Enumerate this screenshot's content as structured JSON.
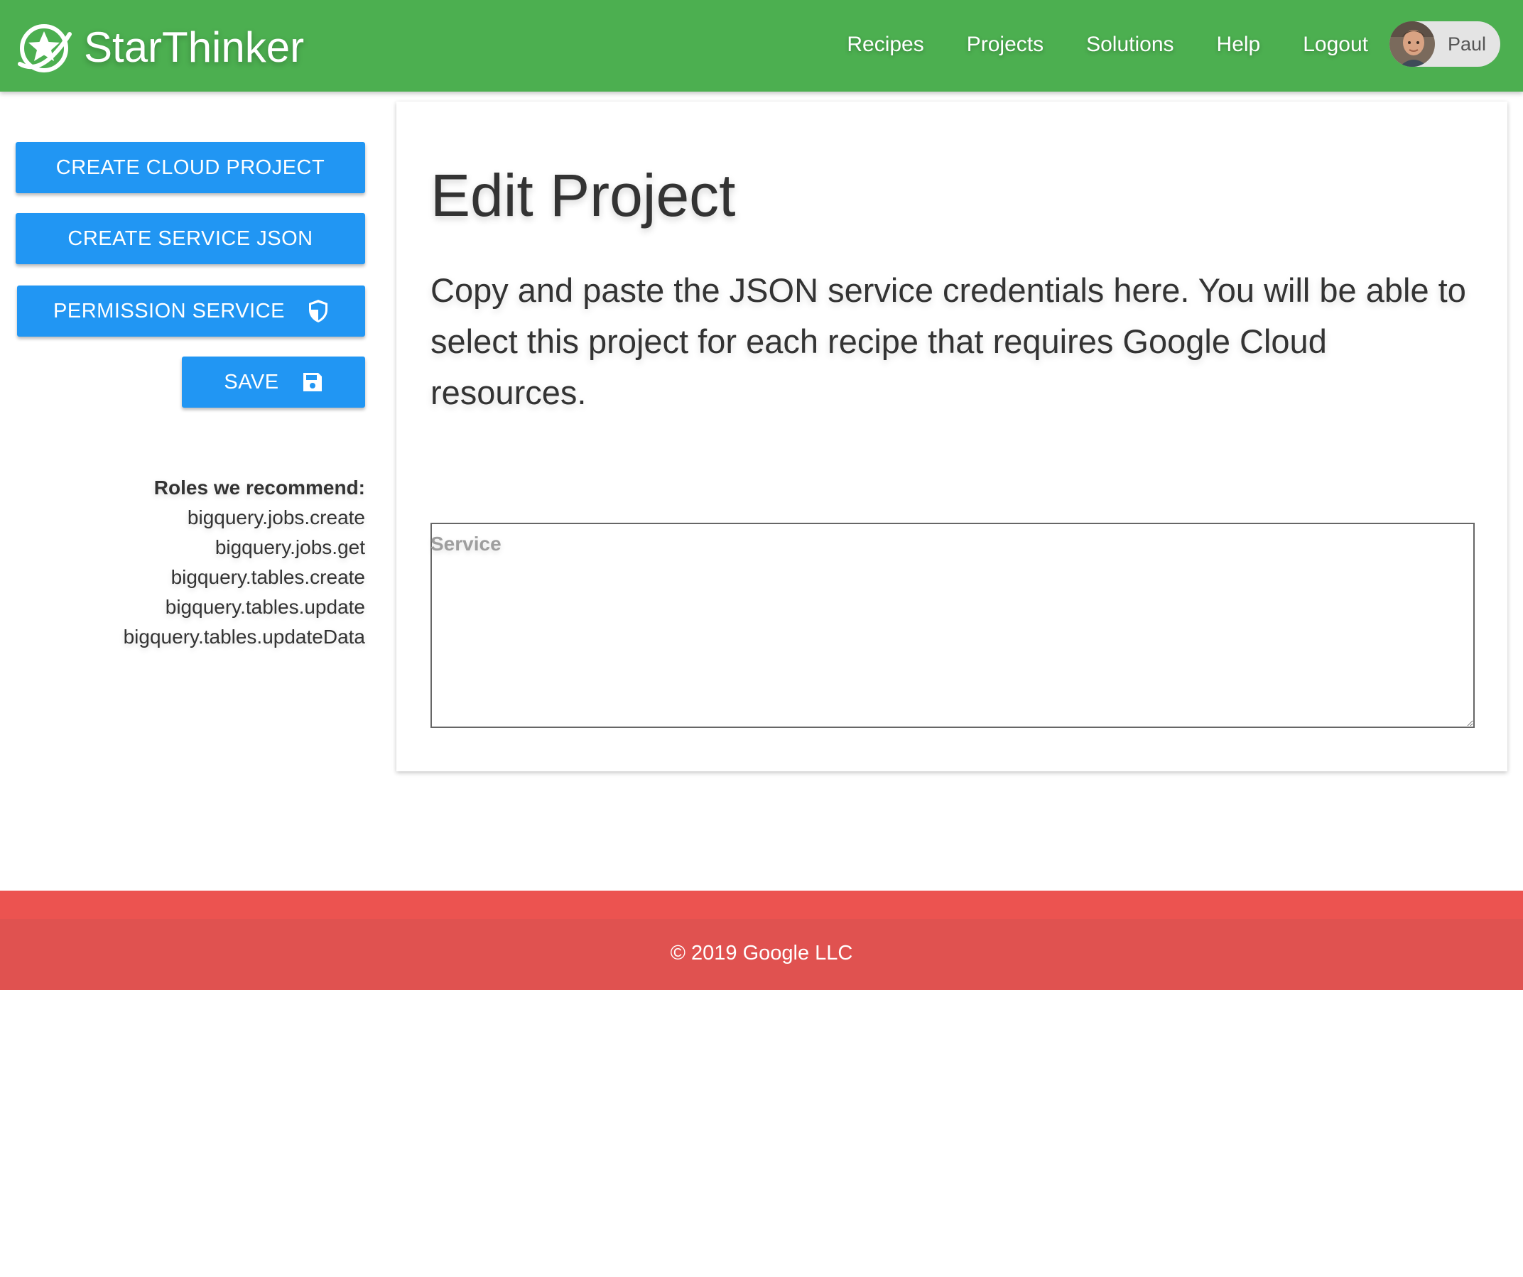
{
  "app": {
    "brand_name": "StarThinker",
    "brand_color": "#4caf50",
    "accent_color": "#2196f3",
    "footer_color": "#e05250"
  },
  "nav": {
    "links": [
      {
        "label": "Recipes"
      },
      {
        "label": "Projects"
      },
      {
        "label": "Solutions"
      },
      {
        "label": "Help"
      },
      {
        "label": "Logout"
      }
    ],
    "user": {
      "name": "Paul",
      "avatar_icon": "avatar-photo"
    }
  },
  "sidebar": {
    "buttons": {
      "create_cloud_project": {
        "label": "CREATE CLOUD PROJECT"
      },
      "create_service_json": {
        "label": "CREATE SERVICE JSON"
      },
      "permission_service": {
        "label": "PERMISSION SERVICE",
        "icon": "shield-icon"
      },
      "save": {
        "label": "SAVE",
        "icon": "floppy-disk-icon"
      }
    },
    "roles": {
      "heading": "Roles we recommend:",
      "items": [
        "bigquery.jobs.create",
        "bigquery.jobs.get",
        "bigquery.tables.create",
        "bigquery.tables.update",
        "bigquery.tables.updateData"
      ]
    }
  },
  "main": {
    "title": "Edit Project",
    "description": "Copy and paste the JSON service credentials here. You will be able to select this project for each recipe that requires Google Cloud resources.",
    "service_field": {
      "label": "Service",
      "value": ""
    }
  },
  "footer": {
    "text": "© 2019 Google LLC"
  }
}
